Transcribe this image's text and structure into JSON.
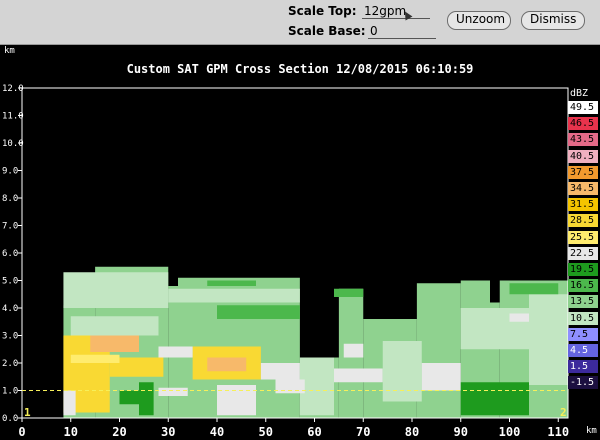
{
  "toolbar": {
    "scale_top_label": "Scale Top:",
    "scale_top_value": "12gpm",
    "scale_base_label": "Scale Base:",
    "scale_base_value": "0",
    "unzoom_label": "Unzoom",
    "dismiss_label": "Dismiss"
  },
  "plot": {
    "title": "Custom   SAT GPM Cross Section 12/08/2015 06:10:59",
    "y_unit": "km",
    "x_unit": "km",
    "endpoint_start": "1",
    "endpoint_end": "2"
  },
  "legend": {
    "title": "dBZ",
    "entries": [
      {
        "label": "49.5",
        "color": "#ffffff",
        "text_color": "#000000"
      },
      {
        "label": "46.5",
        "color": "#e8334c",
        "text_color": "#000000"
      },
      {
        "label": "43.5",
        "color": "#e46a88",
        "text_color": "#000000"
      },
      {
        "label": "40.5",
        "color": "#f0b0c0",
        "text_color": "#000000"
      },
      {
        "label": "37.5",
        "color": "#f29a2e",
        "text_color": "#000000"
      },
      {
        "label": "34.5",
        "color": "#f7b96a",
        "text_color": "#000000"
      },
      {
        "label": "31.5",
        "color": "#f4c400",
        "text_color": "#000000"
      },
      {
        "label": "28.5",
        "color": "#f9d933",
        "text_color": "#000000"
      },
      {
        "label": "25.5",
        "color": "#ffec6e",
        "text_color": "#000000"
      },
      {
        "label": "22.5",
        "color": "#e8e8e8",
        "text_color": "#000000"
      },
      {
        "label": "19.5",
        "color": "#1e9b1e",
        "text_color": "#000000"
      },
      {
        "label": "16.5",
        "color": "#4cb84c",
        "text_color": "#000000"
      },
      {
        "label": "13.5",
        "color": "#8fd28f",
        "text_color": "#000000"
      },
      {
        "label": "10.5",
        "color": "#c2e6c2",
        "text_color": "#000000"
      },
      {
        "label": "7.5",
        "color": "#8f8fff",
        "text_color": "#000000"
      },
      {
        "label": "4.5",
        "color": "#6464e0",
        "text_color": "#ffffff"
      },
      {
        "label": "1.5",
        "color": "#3c2a9c",
        "text_color": "#ffffff"
      },
      {
        "label": "-1.5",
        "color": "#1c1040",
        "text_color": "#ffffff"
      }
    ]
  },
  "chart_data": {
    "type": "heatmap",
    "title": "Custom   SAT GPM Cross Section 12/08/2015 06:10:59",
    "xlabel": "km",
    "ylabel": "km",
    "xlim": [
      0,
      112
    ],
    "ylim": [
      0,
      12
    ],
    "x_ticks": [
      "0",
      "10",
      "20",
      "30",
      "40",
      "50",
      "60",
      "70",
      "80",
      "90",
      "100",
      "110"
    ],
    "y_ticks": [
      "0.0",
      "1.0",
      "2.0",
      "3.0",
      "4.0",
      "5.0",
      "6.0",
      "7.0",
      "8.0",
      "9.0",
      "10.0",
      "11.0",
      "12.0"
    ],
    "freezing_level_km": 1.0,
    "echo_top_profile": [
      {
        "x": 8.5,
        "top": 4.1
      },
      {
        "x": 15,
        "top": 5.5
      },
      {
        "x": 30,
        "top": 4.8
      },
      {
        "x": 32,
        "top": 5.1
      },
      {
        "x": 57,
        "top": 2.2
      },
      {
        "x": 65,
        "top": 4.7
      },
      {
        "x": 70,
        "top": 3.6
      },
      {
        "x": 81,
        "top": 4.9
      },
      {
        "x": 90,
        "top": 5.0
      },
      {
        "x": 96,
        "top": 4.2
      },
      {
        "x": 98,
        "top": 5.0
      },
      {
        "x": 112,
        "top": 5.0
      }
    ]
  }
}
